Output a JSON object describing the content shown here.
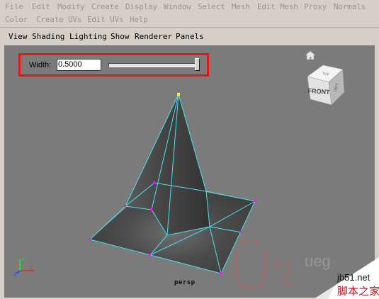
{
  "menu_bar": {
    "row1": [
      "File",
      "Edit",
      "Modify",
      "Create",
      "Display",
      "Window",
      "Select",
      "Mesh",
      "Edit Mesh",
      "Proxy",
      "Normals"
    ],
    "row2": [
      "Color",
      "Create UVs",
      "Edit UVs",
      "Help"
    ]
  },
  "panel_menu": [
    "View",
    "Shading",
    "Lighting",
    "Show",
    "Renderer",
    "Panels"
  ],
  "tool_settings": {
    "width_label": "Width:",
    "width_value": "0.5000",
    "slider_level": 0.98
  },
  "view_cube": {
    "front_label": "FRONT",
    "top_label": "TOP",
    "side_label": "LEFT"
  },
  "viewport": {
    "camera_label": "persp",
    "background_color": "#7b7b7b",
    "mesh_color": "#4a4a4a",
    "edge_color": "#49e3ee",
    "vertex_color": "#e020e0",
    "selected_vertex_color": "#ffff00"
  },
  "axis": {
    "x": "x",
    "y": "y",
    "z": "z"
  },
  "watermark": {
    "logo_text": "ueg",
    "site": "jb51.net",
    "site_cn": "脚本之家"
  }
}
